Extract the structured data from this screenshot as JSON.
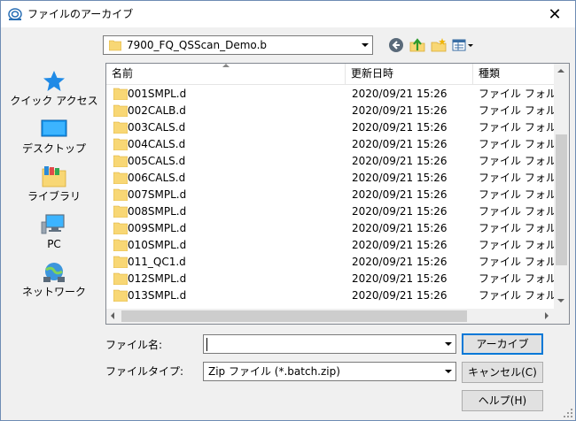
{
  "window": {
    "title": "ファイルのアーカイブ",
    "close_glyph": "✕"
  },
  "location": {
    "value": "7900_FQ_QSScan_Demo.b"
  },
  "places": [
    {
      "label": "クイック アクセス",
      "icon": "star-icon"
    },
    {
      "label": "デスクトップ",
      "icon": "desktop-icon"
    },
    {
      "label": "ライブラリ",
      "icon": "library-icon"
    },
    {
      "label": "PC",
      "icon": "pc-icon"
    },
    {
      "label": "ネットワーク",
      "icon": "network-icon"
    }
  ],
  "columns": {
    "name": "名前",
    "date": "更新日時",
    "type": "種類"
  },
  "files": [
    {
      "name": "001SMPL.d",
      "date": "2020/09/21 15:26",
      "type": "ファイル フォルダー"
    },
    {
      "name": "002CALB.d",
      "date": "2020/09/21 15:26",
      "type": "ファイル フォルダー"
    },
    {
      "name": "003CALS.d",
      "date": "2020/09/21 15:26",
      "type": "ファイル フォルダー"
    },
    {
      "name": "004CALS.d",
      "date": "2020/09/21 15:26",
      "type": "ファイル フォルダー"
    },
    {
      "name": "005CALS.d",
      "date": "2020/09/21 15:26",
      "type": "ファイル フォルダー"
    },
    {
      "name": "006CALS.d",
      "date": "2020/09/21 15:26",
      "type": "ファイル フォルダー"
    },
    {
      "name": "007SMPL.d",
      "date": "2020/09/21 15:26",
      "type": "ファイル フォルダー"
    },
    {
      "name": "008SMPL.d",
      "date": "2020/09/21 15:26",
      "type": "ファイル フォルダー"
    },
    {
      "name": "009SMPL.d",
      "date": "2020/09/21 15:26",
      "type": "ファイル フォルダー"
    },
    {
      "name": "010SMPL.d",
      "date": "2020/09/21 15:26",
      "type": "ファイル フォルダー"
    },
    {
      "name": "011_QC1.d",
      "date": "2020/09/21 15:26",
      "type": "ファイル フォルダー"
    },
    {
      "name": "012SMPL.d",
      "date": "2020/09/21 15:26",
      "type": "ファイル フォルダー"
    },
    {
      "name": "013SMPL.d",
      "date": "2020/09/21 15:26",
      "type": "ファイル フォルダー"
    }
  ],
  "form": {
    "filename_label": "ファイル名:",
    "filename_value": "",
    "filetype_label": "ファイルタイプ:",
    "filetype_value": "Zip ファイル (*.batch.zip)"
  },
  "buttons": {
    "archive": "アーカイブ",
    "cancel": "キャンセル(C)",
    "help": "ヘルプ(H)"
  },
  "colors": {
    "folder": "#f8d775",
    "accent": "#0078d7"
  }
}
